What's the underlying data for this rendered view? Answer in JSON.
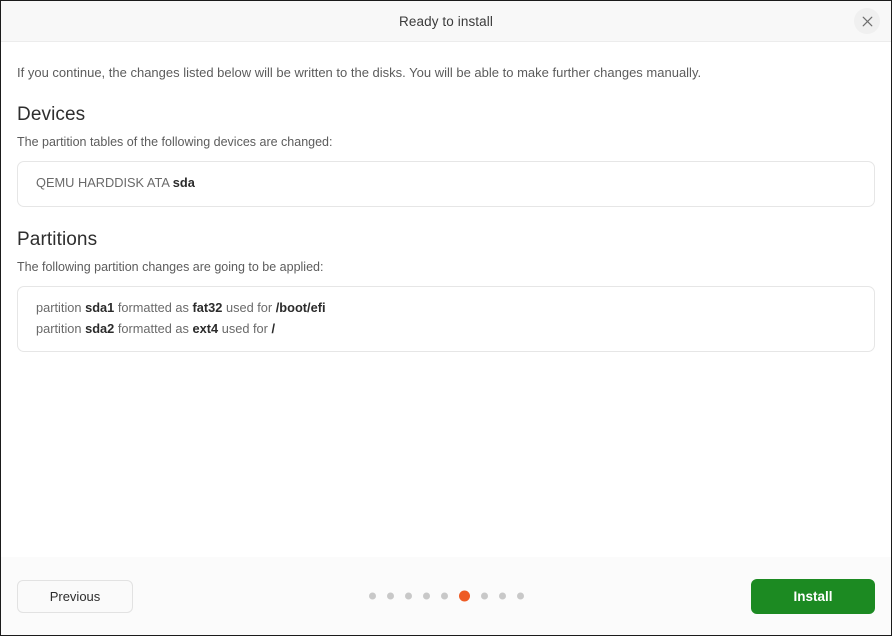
{
  "window": {
    "title": "Ready to install",
    "close_label": "×"
  },
  "intro": "If you continue, the changes listed below will be written to the disks. You will be able to make further changes manually.",
  "devices": {
    "heading": "Devices",
    "subtitle": "The partition tables of the following devices are changed:",
    "items": [
      {
        "prefix": "QEMU HARDDISK ATA ",
        "name": "sda"
      }
    ]
  },
  "partitions": {
    "heading": "Partitions",
    "subtitle": "The following partition changes are going to be applied:",
    "items": [
      {
        "lead": "partition ",
        "device": "sda1",
        "mid": " formatted as ",
        "filesystem": "fat32",
        "tail": " used for ",
        "mountpoint": "/boot/efi"
      },
      {
        "lead": "partition ",
        "device": "sda2",
        "mid": " formatted as ",
        "filesystem": "ext4",
        "tail": " used for ",
        "mountpoint": "/"
      }
    ]
  },
  "footer": {
    "previous_label": "Previous",
    "install_label": "Install",
    "pagination": {
      "total": 9,
      "active_index": 6
    }
  },
  "colors": {
    "accent": "#ee5b24",
    "install_green": "#1c8a22",
    "dot_inactive": "#c8c8c8"
  }
}
